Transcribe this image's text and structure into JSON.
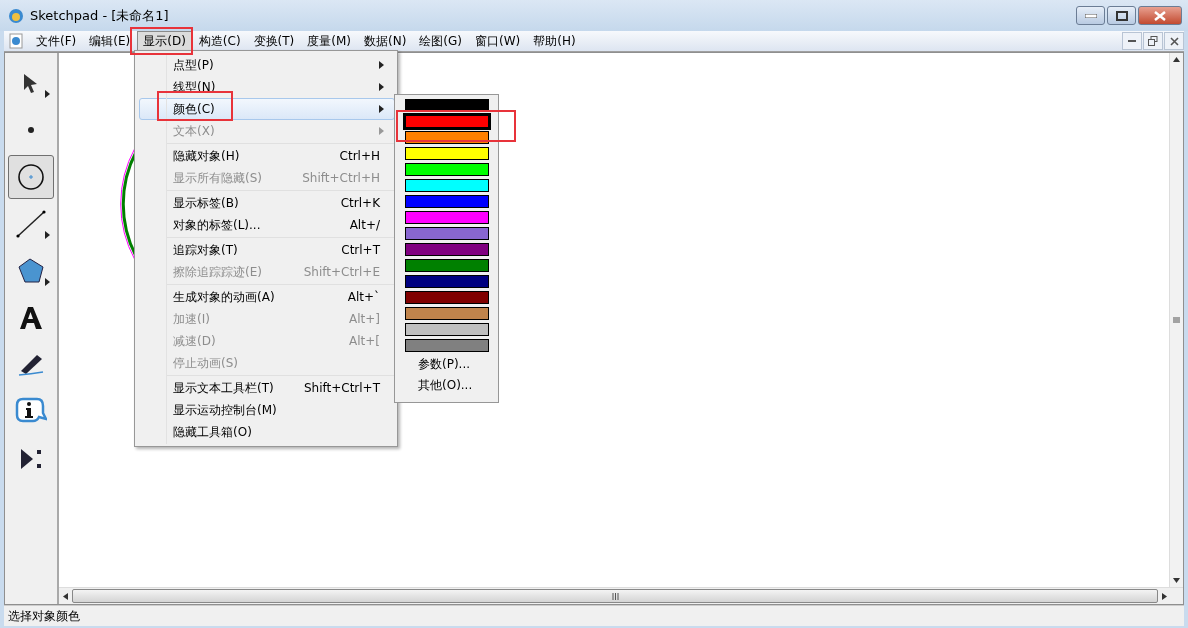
{
  "window": {
    "title": "Sketchpad  - [未命名1]"
  },
  "menubar": [
    {
      "label": "文件(F)",
      "selected": false
    },
    {
      "label": "编辑(E)",
      "selected": false
    },
    {
      "label": "显示(D)",
      "selected": true
    },
    {
      "label": "构造(C)",
      "selected": false
    },
    {
      "label": "变换(T)",
      "selected": false
    },
    {
      "label": "度量(M)",
      "selected": false
    },
    {
      "label": "数据(N)",
      "selected": false
    },
    {
      "label": "绘图(G)",
      "selected": false
    },
    {
      "label": "窗口(W)",
      "selected": false
    },
    {
      "label": "帮助(H)",
      "selected": false
    }
  ],
  "toolbox": [
    {
      "kind": "arrow",
      "selected": false
    },
    {
      "kind": "point",
      "selected": false
    },
    {
      "kind": "compass",
      "selected": true
    },
    {
      "kind": "line",
      "selected": false
    },
    {
      "kind": "polygon",
      "selected": false
    },
    {
      "kind": "text",
      "selected": false
    },
    {
      "kind": "marker",
      "selected": false
    },
    {
      "kind": "info",
      "selected": false
    },
    {
      "kind": "custom",
      "selected": false
    }
  ],
  "menu": {
    "groups": [
      [
        {
          "label": "点型(P)",
          "submenu": true,
          "disabled": false,
          "selected": false
        },
        {
          "label": "线型(N)",
          "submenu": true,
          "disabled": false,
          "selected": false
        },
        {
          "label": "颜色(C)",
          "submenu": true,
          "disabled": false,
          "selected": true
        },
        {
          "label": "文本(X)",
          "submenu": true,
          "disabled": true,
          "selected": false
        }
      ],
      [
        {
          "label": "隐藏对象(H)",
          "shortcut": "Ctrl+H",
          "disabled": false,
          "selected": false
        },
        {
          "label": "显示所有隐藏(S)",
          "shortcut": "Shift+Ctrl+H",
          "disabled": true,
          "selected": false
        }
      ],
      [
        {
          "label": "显示标签(B)",
          "shortcut": "Ctrl+K",
          "disabled": false,
          "selected": false
        },
        {
          "label": "对象的标签(L)...",
          "shortcut": "Alt+/",
          "disabled": false,
          "selected": false
        }
      ],
      [
        {
          "label": "追踪对象(T)",
          "shortcut": "Ctrl+T",
          "disabled": false,
          "selected": false
        },
        {
          "label": "擦除追踪踪迹(E)",
          "shortcut": "Shift+Ctrl+E",
          "disabled": true,
          "selected": false
        }
      ],
      [
        {
          "label": "生成对象的动画(A)",
          "shortcut": "Alt+`",
          "disabled": false,
          "selected": false
        },
        {
          "label": "加速(I)",
          "shortcut": "Alt+]",
          "disabled": true,
          "selected": false
        },
        {
          "label": "减速(D)",
          "shortcut": "Alt+[",
          "disabled": true,
          "selected": false
        },
        {
          "label": "停止动画(S)",
          "disabled": true,
          "selected": false
        }
      ],
      [
        {
          "label": "显示文本工具栏(T)",
          "shortcut": "Shift+Ctrl+T",
          "disabled": false,
          "selected": false
        },
        {
          "label": "显示运动控制台(M)",
          "disabled": false,
          "selected": false
        },
        {
          "label": "隐藏工具箱(O)",
          "disabled": false,
          "selected": false
        }
      ]
    ]
  },
  "color_menu": {
    "swatches": [
      {
        "color": "#000000",
        "selected": false
      },
      {
        "color": "#ff0000",
        "selected": true
      },
      {
        "color": "#ff8000",
        "selected": false
      },
      {
        "color": "#ffff00",
        "selected": false
      },
      {
        "color": "#00ff00",
        "selected": false
      },
      {
        "color": "#00ffff",
        "selected": false
      },
      {
        "color": "#0000ff",
        "selected": false
      },
      {
        "color": "#ff00ff",
        "selected": false
      },
      {
        "color": "#8866d0",
        "selected": false
      },
      {
        "color": "#800080",
        "selected": false
      },
      {
        "color": "#008000",
        "selected": false
      },
      {
        "color": "#000080",
        "selected": false
      },
      {
        "color": "#800000",
        "selected": false
      },
      {
        "color": "#c0844c",
        "selected": false
      },
      {
        "color": "#c0c0c0",
        "selected": false
      },
      {
        "color": "#808080",
        "selected": false
      }
    ],
    "items": [
      "参数(P)...",
      "其他(O)..."
    ]
  },
  "status_bar": "选择对象颜色"
}
